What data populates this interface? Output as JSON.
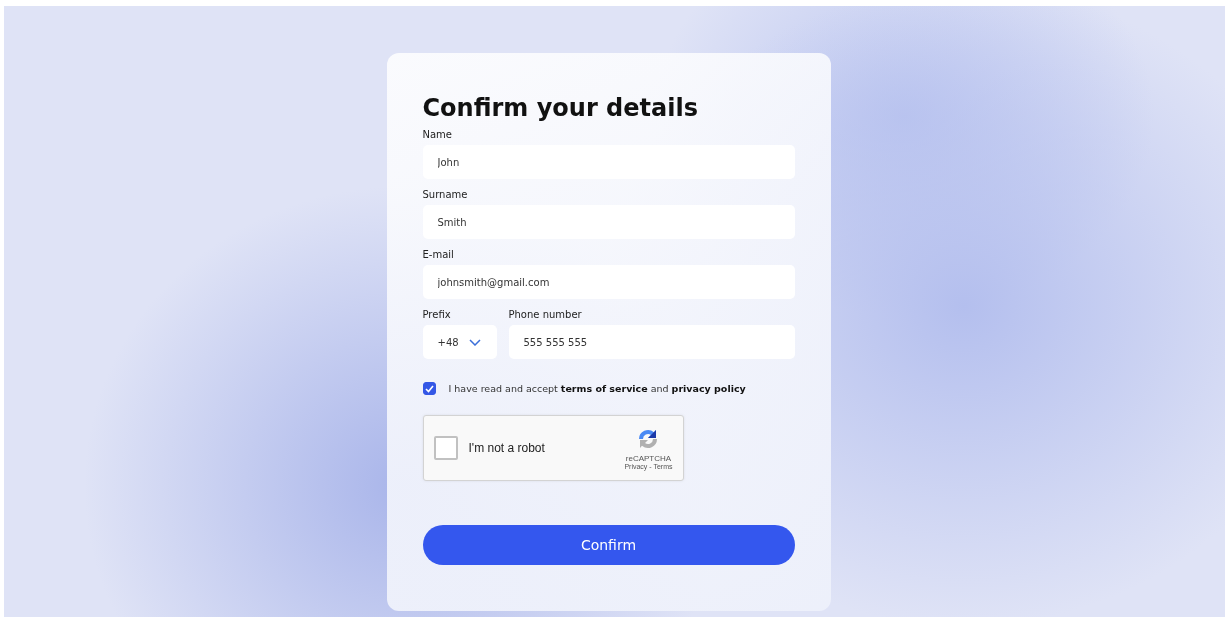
{
  "title": "Confirm your details",
  "fields": [
    {
      "label": "Name",
      "value": "John"
    },
    {
      "label": "Surname",
      "value": "Smith"
    },
    {
      "label": "E-mail",
      "value": "johnsmith@gmail.com"
    }
  ],
  "phone": {
    "prefix_label": "Prefix",
    "prefix": "+48",
    "number_label": "Phone number",
    "number": "555 555 555"
  },
  "terms": {
    "checked": true,
    "text": "I have read and accept **terms of service** and **privacy policy**"
  },
  "captcha": {
    "checked": false,
    "label": "I'm not a robot",
    "brand": "reCAPTCHA",
    "links": "Privacy - Terms"
  },
  "button": "Confirm"
}
